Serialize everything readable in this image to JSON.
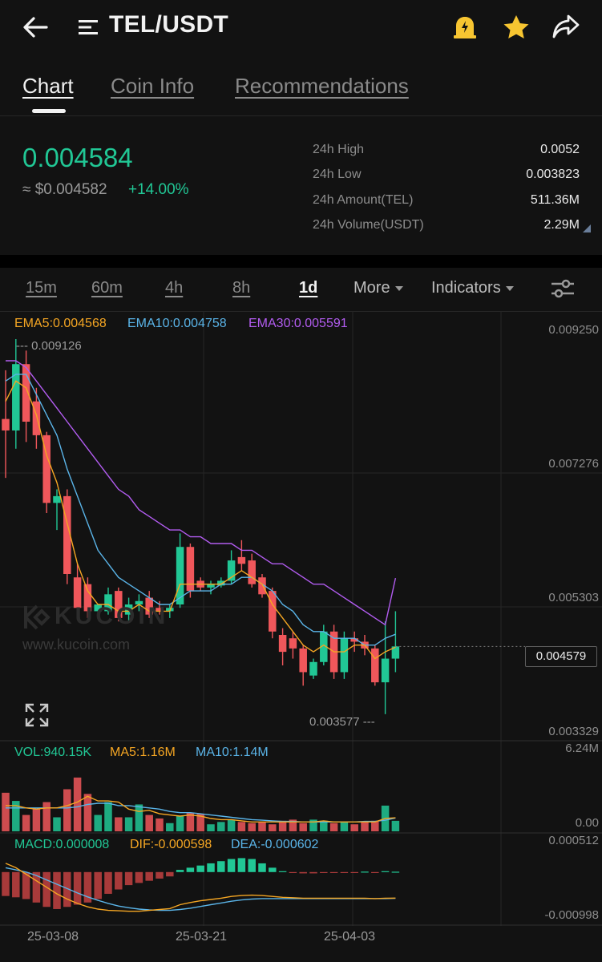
{
  "header": {
    "title": "TEL/USDT",
    "back_icon": "arrow-left-icon",
    "menu_icon": "list-menu-icon",
    "alert_icon": "price-alert-icon",
    "favorite_icon": "star-icon",
    "share_icon": "share-icon",
    "accent_color": "#f7c531"
  },
  "tabs": [
    {
      "label": "Chart",
      "active": true
    },
    {
      "label": "Coin Info",
      "active": false
    },
    {
      "label": "Recommendations",
      "active": false
    }
  ],
  "price": {
    "last": "0.004584",
    "usd": "≈ $0.004582",
    "change": "+14.00%",
    "up_color": "#21c795",
    "down_color": "#f0575b"
  },
  "stats": [
    {
      "label": "24h High",
      "value": "0.0052"
    },
    {
      "label": "24h Low",
      "value": "0.003823"
    },
    {
      "label": "24h Amount(TEL)",
      "value": "511.36M"
    },
    {
      "label": "24h Volume(USDT)",
      "value": "2.29M"
    }
  ],
  "timeframes": [
    {
      "label": "15m",
      "active": false
    },
    {
      "label": "60m",
      "active": false
    },
    {
      "label": "4h",
      "active": false
    },
    {
      "label": "8h",
      "active": false
    },
    {
      "label": "1d",
      "active": true
    }
  ],
  "toolbar": {
    "more": "More",
    "indicators": "Indicators",
    "settings_icon": "sliders-icon"
  },
  "ema_legend": {
    "ema5": "EMA5:0.004568",
    "ema10": "EMA10:0.004758",
    "ema30": "EMA30:0.005591",
    "ema5_color": "#f5a623",
    "ema10_color": "#5ab4e8",
    "ema30_color": "#b25cf0"
  },
  "price_axis": [
    "0.009250",
    "0.007276",
    "0.005303",
    "0.003329"
  ],
  "current_price_tag": "0.004579",
  "high_marker": "0.009126",
  "low_marker": "0.003577",
  "watermark": {
    "name": "KUCOIN",
    "url": "www.kucoin.com",
    "logo_icon": "kucoin-logo-icon"
  },
  "expand_icon": "expand-icon",
  "volume_legend": {
    "vol": "VOL:940.15K",
    "ma5": "MA5:1.16M",
    "ma10": "MA10:1.14M"
  },
  "volume_axis": [
    "6.24M",
    "0.00"
  ],
  "macd_legend": {
    "macd": "MACD:0.000008",
    "dif": "DIF:-0.000598",
    "dea": "DEA:-0.000602"
  },
  "macd_axis": [
    "0.000512",
    "-0.000998"
  ],
  "dates": [
    "25-03-08",
    "25-03-21",
    "25-04-03"
  ],
  "chart_data": {
    "type": "candlestick",
    "pair": "TEL/USDT",
    "interval": "1d",
    "ylim": [
      0.003329,
      0.00925
    ],
    "candles": [
      {
        "o": 0.00794,
        "h": 0.00866,
        "l": 0.00707,
        "c": 0.00777
      },
      {
        "o": 0.00777,
        "h": 0.00912,
        "l": 0.0075,
        "c": 0.00875
      },
      {
        "o": 0.00875,
        "h": 0.00895,
        "l": 0.0076,
        "c": 0.0079
      },
      {
        "o": 0.0082,
        "h": 0.0084,
        "l": 0.0075,
        "c": 0.0077
      },
      {
        "o": 0.0077,
        "h": 0.00775,
        "l": 0.00655,
        "c": 0.0067
      },
      {
        "o": 0.0067,
        "h": 0.0069,
        "l": 0.0063,
        "c": 0.0068
      },
      {
        "o": 0.0068,
        "h": 0.0069,
        "l": 0.0055,
        "c": 0.00565
      },
      {
        "o": 0.0056,
        "h": 0.0058,
        "l": 0.005,
        "c": 0.00515
      },
      {
        "o": 0.0055,
        "h": 0.0056,
        "l": 0.005,
        "c": 0.0051
      },
      {
        "o": 0.0051,
        "h": 0.0052,
        "l": 0.00505,
        "c": 0.0052
      },
      {
        "o": 0.0051,
        "h": 0.00545,
        "l": 0.00505,
        "c": 0.00535
      },
      {
        "o": 0.0054,
        "h": 0.00545,
        "l": 0.00495,
        "c": 0.005
      },
      {
        "o": 0.00505,
        "h": 0.0053,
        "l": 0.00495,
        "c": 0.0052
      },
      {
        "o": 0.0052,
        "h": 0.00535,
        "l": 0.0051,
        "c": 0.00525
      },
      {
        "o": 0.0053,
        "h": 0.0054,
        "l": 0.005,
        "c": 0.00505
      },
      {
        "o": 0.00515,
        "h": 0.00525,
        "l": 0.00505,
        "c": 0.0051
      },
      {
        "o": 0.0051,
        "h": 0.0052,
        "l": 0.005,
        "c": 0.00515
      },
      {
        "o": 0.0052,
        "h": 0.00625,
        "l": 0.00515,
        "c": 0.00605
      },
      {
        "o": 0.00605,
        "h": 0.0061,
        "l": 0.0053,
        "c": 0.0054
      },
      {
        "o": 0.00555,
        "h": 0.0056,
        "l": 0.0054,
        "c": 0.00545
      },
      {
        "o": 0.00545,
        "h": 0.00555,
        "l": 0.00535,
        "c": 0.0055
      },
      {
        "o": 0.00548,
        "h": 0.0056,
        "l": 0.00545,
        "c": 0.00555
      },
      {
        "o": 0.00555,
        "h": 0.006,
        "l": 0.0055,
        "c": 0.00585
      },
      {
        "o": 0.0059,
        "h": 0.00615,
        "l": 0.0057,
        "c": 0.0058
      },
      {
        "o": 0.00585,
        "h": 0.00595,
        "l": 0.00545,
        "c": 0.0055
      },
      {
        "o": 0.0056,
        "h": 0.00565,
        "l": 0.0053,
        "c": 0.00535
      },
      {
        "o": 0.0054,
        "h": 0.00545,
        "l": 0.0047,
        "c": 0.0048
      },
      {
        "o": 0.00475,
        "h": 0.00485,
        "l": 0.0043,
        "c": 0.0045
      },
      {
        "o": 0.0047,
        "h": 0.0048,
        "l": 0.0044,
        "c": 0.00455
      },
      {
        "o": 0.00455,
        "h": 0.0046,
        "l": 0.004,
        "c": 0.0042
      },
      {
        "o": 0.00415,
        "h": 0.0044,
        "l": 0.0041,
        "c": 0.00435
      },
      {
        "o": 0.00435,
        "h": 0.0049,
        "l": 0.0043,
        "c": 0.0048
      },
      {
        "o": 0.0048,
        "h": 0.0049,
        "l": 0.0041,
        "c": 0.0042
      },
      {
        "o": 0.0042,
        "h": 0.0048,
        "l": 0.0041,
        "c": 0.0047
      },
      {
        "o": 0.0047,
        "h": 0.0048,
        "l": 0.0045,
        "c": 0.00465
      },
      {
        "o": 0.00465,
        "h": 0.00475,
        "l": 0.00445,
        "c": 0.00455
      },
      {
        "o": 0.00455,
        "h": 0.0046,
        "l": 0.004,
        "c": 0.00405
      },
      {
        "o": 0.00405,
        "h": 0.00495,
        "l": 0.00358,
        "c": 0.0044
      },
      {
        "o": 0.0044,
        "h": 0.0051,
        "l": 0.0042,
        "c": 0.00458
      }
    ],
    "ema5": [
      0.0082,
      0.0085,
      0.0084,
      0.008,
      0.0074,
      0.007,
      0.0064,
      0.0058,
      0.0054,
      0.0052,
      0.0052,
      0.0051,
      0.0051,
      0.0052,
      0.0051,
      0.0051,
      0.0051,
      0.0055,
      0.0055,
      0.0055,
      0.0055,
      0.0055,
      0.0056,
      0.0057,
      0.0056,
      0.0055,
      0.0052,
      0.005,
      0.0048,
      0.0046,
      0.0045,
      0.0046,
      0.0045,
      0.0045,
      0.0046,
      0.0046,
      0.0044,
      0.0045,
      0.00457
    ],
    "ema10": [
      0.0085,
      0.0086,
      0.0086,
      0.0083,
      0.008,
      0.0077,
      0.0072,
      0.0068,
      0.0064,
      0.006,
      0.0058,
      0.0056,
      0.0055,
      0.0054,
      0.0053,
      0.0052,
      0.0052,
      0.0053,
      0.0054,
      0.0054,
      0.0054,
      0.0055,
      0.0055,
      0.0056,
      0.0056,
      0.0055,
      0.0054,
      0.0052,
      0.0051,
      0.0049,
      0.0048,
      0.0048,
      0.0047,
      0.0047,
      0.0047,
      0.0046,
      0.0046,
      0.0047,
      0.00476
    ],
    "ema30": [
      0.0088,
      0.0088,
      0.0087,
      0.0085,
      0.0083,
      0.0081,
      0.0079,
      0.0077,
      0.0075,
      0.0073,
      0.0071,
      0.0069,
      0.0068,
      0.0066,
      0.0065,
      0.0064,
      0.0063,
      0.0063,
      0.0062,
      0.0062,
      0.0061,
      0.0061,
      0.0061,
      0.006,
      0.006,
      0.0059,
      0.0058,
      0.0058,
      0.0057,
      0.0056,
      0.0055,
      0.0055,
      0.0054,
      0.0053,
      0.0052,
      0.0051,
      0.005,
      0.0049,
      0.00559
    ],
    "volume": {
      "ylim": [
        0,
        6.24
      ],
      "unit": "M",
      "values": [
        3.3,
        2.6,
        1.4,
        1.9,
        2.5,
        1.2,
        3.6,
        4.6,
        3.2,
        1.4,
        2.5,
        1.2,
        1.2,
        2.3,
        1.4,
        1.1,
        0.7,
        1.3,
        1.6,
        1.5,
        0.6,
        0.8,
        1.0,
        0.8,
        0.7,
        0.8,
        0.6,
        0.9,
        1.0,
        0.7,
        1.0,
        0.9,
        0.7,
        0.8,
        0.6,
        0.8,
        0.9,
        2.2,
        0.9
      ],
      "ma5": [
        2.2,
        2.2,
        2.0,
        1.9,
        2.0,
        2.0,
        2.2,
        2.5,
        3.0,
        2.6,
        2.6,
        2.5,
        1.9,
        1.7,
        1.8,
        1.5,
        1.4,
        1.3,
        1.4,
        1.3,
        1.1,
        1.0,
        1.0,
        0.9,
        0.8,
        0.8,
        0.8,
        0.8,
        0.8,
        0.8,
        0.8,
        0.9,
        0.8,
        0.8,
        0.8,
        0.8,
        0.8,
        1.1,
        1.16
      ],
      "ma10": [
        2.0,
        2.0,
        2.0,
        2.0,
        2.0,
        2.0,
        2.0,
        2.1,
        2.3,
        2.4,
        2.4,
        2.2,
        2.2,
        2.1,
        2.0,
        1.9,
        1.7,
        1.6,
        1.6,
        1.5,
        1.4,
        1.3,
        1.2,
        1.1,
        1.0,
        0.95,
        0.9,
        0.85,
        0.85,
        0.8,
        0.8,
        0.8,
        0.8,
        0.8,
        0.8,
        0.85,
        0.85,
        0.95,
        1.14
      ]
    },
    "macd": {
      "ylim": [
        -0.000998,
        0.000512
      ],
      "hist": [
        -0.00055,
        -0.00058,
        -0.00062,
        -0.0007,
        -0.0008,
        -0.00085,
        -0.0008,
        -0.00075,
        -0.0007,
        -0.00062,
        -0.0005,
        -0.0004,
        -0.0003,
        -0.00025,
        -0.0002,
        -0.00015,
        -0.0001,
        5e-05,
        0.0001,
        0.00015,
        0.0002,
        0.00025,
        0.0003,
        0.00032,
        0.0003,
        0.0002,
        0.0001,
        2e-05,
        -2e-05,
        -3e-05,
        -3e-05,
        -2e-05,
        -2e-05,
        -1e-05,
        -1e-05,
        1e-05,
        -1e-05,
        2e-05,
        8e-06
      ],
      "dif": [
        0.0002,
        0.0001,
        -5e-05,
        -0.0002,
        -0.00035,
        -0.0005,
        -0.00062,
        -0.00072,
        -0.0008,
        -0.00085,
        -0.00088,
        -0.00089,
        -0.0009,
        -0.0009,
        -0.00088,
        -0.00086,
        -0.00084,
        -0.00075,
        -0.0007,
        -0.00066,
        -0.00063,
        -0.0006,
        -0.00056,
        -0.00054,
        -0.00053,
        -0.00054,
        -0.00056,
        -0.00058,
        -0.00059,
        -0.0006,
        -0.0006,
        -0.0006,
        -0.0006,
        -0.0006,
        -0.0006,
        -0.0006,
        -0.00061,
        -0.0006,
        -0.000598
      ],
      "dea": [
        0.0001,
        5e-05,
        0.0,
        -8e-05,
        -0.00018,
        -0.00028,
        -0.00038,
        -0.00048,
        -0.00057,
        -0.00065,
        -0.00072,
        -0.00078,
        -0.00082,
        -0.00085,
        -0.00087,
        -0.00088,
        -0.00088,
        -0.00086,
        -0.00083,
        -0.00079,
        -0.00075,
        -0.00071,
        -0.00067,
        -0.00064,
        -0.00062,
        -0.00061,
        -0.00061,
        -0.00061,
        -0.00061,
        -0.00061,
        -0.00061,
        -0.00061,
        -0.00061,
        -0.00061,
        -0.00061,
        -0.00061,
        -0.00061,
        -0.00061,
        -0.000602
      ]
    },
    "dates": [
      "25-03-08",
      "25-03-21",
      "25-04-03"
    ]
  }
}
